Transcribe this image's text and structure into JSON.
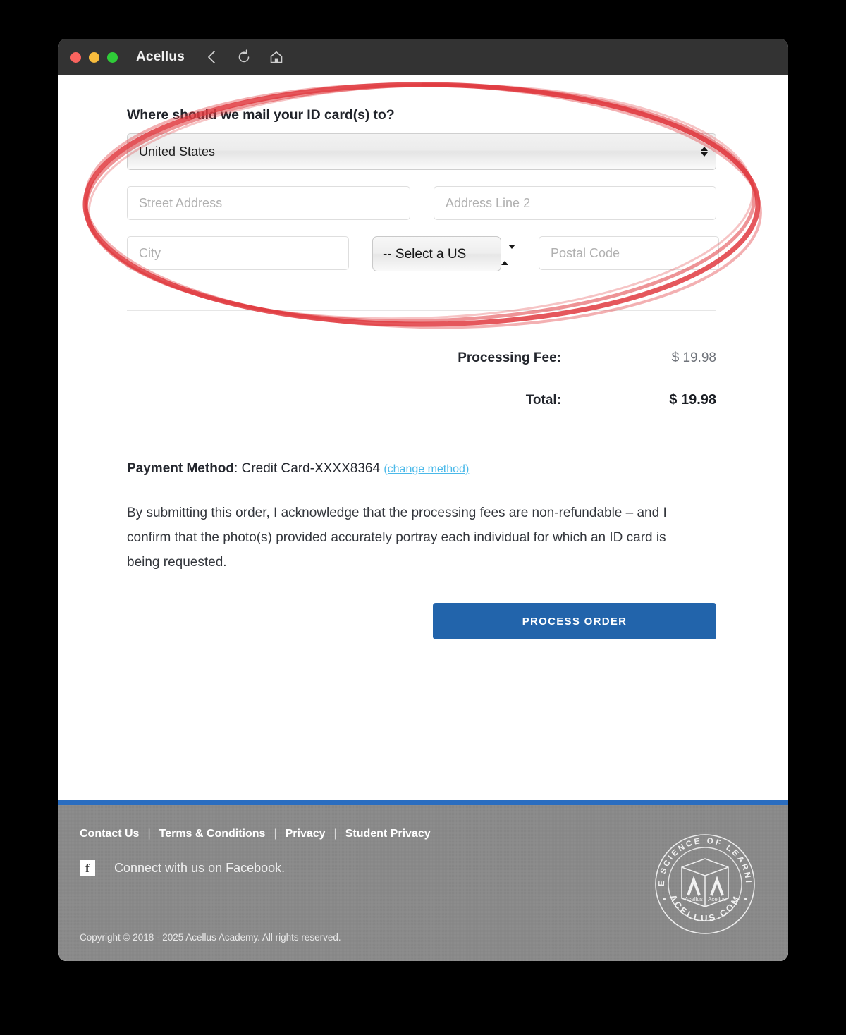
{
  "window": {
    "title": "Acellus",
    "traffic_lights": [
      "close-red",
      "minimize-yellow",
      "maximize-green"
    ],
    "nav": {
      "back": "back-chevron-icon",
      "reload": "reload-icon",
      "home": "home-icon"
    }
  },
  "address": {
    "heading": "Where should we mail your ID card(s) to?",
    "country_value": "United States",
    "street_placeholder": "Street Address",
    "line2_placeholder": "Address Line 2",
    "city_placeholder": "City",
    "state_value": "-- Select a US",
    "postal_placeholder": "Postal Code"
  },
  "totals": {
    "fee_label": "Processing Fee:",
    "fee_value": "$ 19.98",
    "total_label": "Total:",
    "total_value": "$ 19.98"
  },
  "payment": {
    "label": "Payment Method",
    "separator": ": ",
    "value": "Credit Card-XXXX8364",
    "change_link": "(change method)",
    "acknowledgement": "By submitting this order, I acknowledge that the processing fees are non-refundable – and I confirm that the photo(s) provided accurately portray each individual for which an ID card is being requested.",
    "process_button": "PROCESS ORDER"
  },
  "footer": {
    "links": [
      "Contact Us",
      "Terms & Conditions",
      "Privacy",
      "Student Privacy"
    ],
    "separator": "|",
    "facebook_icon": "facebook-icon",
    "facebook_text": "Connect with us on Facebook.",
    "copyright": "Copyright © 2018 - 2025 Acellus Academy. All rights reserved.",
    "seal": {
      "top_text": "THE SCIENCE OF LEARNING",
      "bottom_text": "ACELLUS.COM",
      "cube_label_left": "Acellus",
      "cube_label_right": "Acellus"
    }
  },
  "annotation": {
    "shape": "ellipse",
    "color": "#e03a3f",
    "target": "address-form-section"
  },
  "colors": {
    "titlebar": "#333333",
    "accent_blue": "#2264ab",
    "footer_gray": "#8a8a8a",
    "link_blue": "#4bb9e9",
    "annotation_red": "#e03a3f"
  }
}
